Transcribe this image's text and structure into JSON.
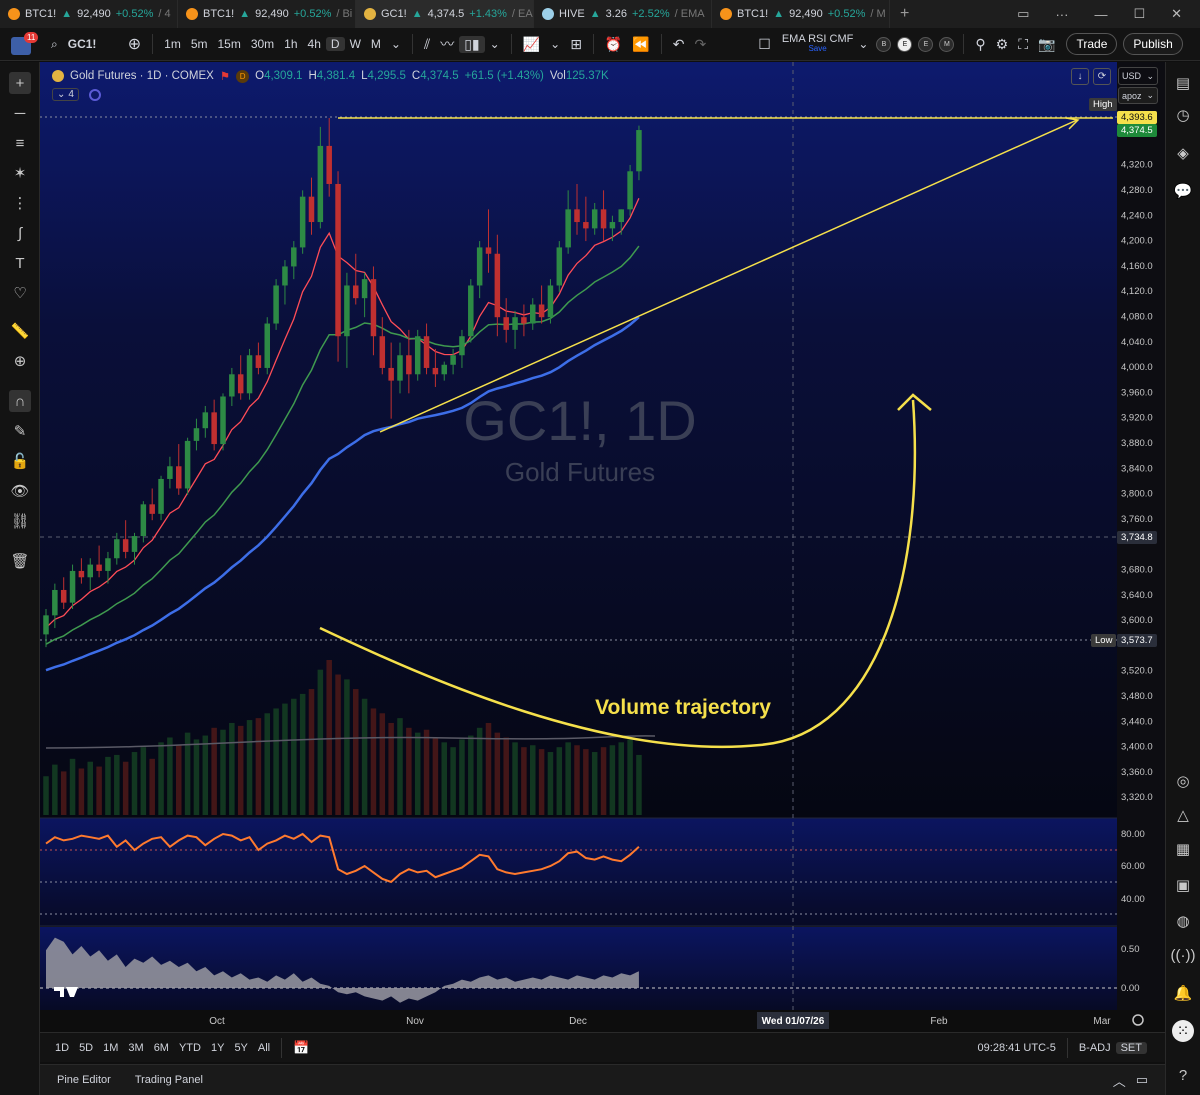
{
  "tabs": [
    {
      "symbol": "BTC1!",
      "price": "92,490",
      "change": "+0.52%",
      "extra": "/ 4"
    },
    {
      "symbol": "BTC1!",
      "price": "92,490",
      "change": "+0.52%",
      "extra": "/ Bi"
    },
    {
      "symbol": "GC1!",
      "price": "4,374.5",
      "change": "+1.43%",
      "extra": "/ EA"
    },
    {
      "symbol": "HIVE",
      "price": "3.26",
      "change": "+2.52%",
      "extra": "/ EMA"
    },
    {
      "symbol": "BTC1!",
      "price": "92,490",
      "change": "+0.52%",
      "extra": "/ M"
    }
  ],
  "toolbar": {
    "badge": "11",
    "symbol": "GC1!",
    "intervals": [
      "1m",
      "5m",
      "15m",
      "30m",
      "1h",
      "4h",
      "D",
      "W",
      "M"
    ],
    "indicators": "EMA RSI CMF",
    "save": "Save",
    "circles": [
      "B",
      "E",
      "E",
      "M"
    ],
    "trade": "Trade",
    "publish": "Publish"
  },
  "legend": {
    "title": "Gold Futures · 1D · COMEX",
    "open": "4,309.1",
    "high": "4,381.4",
    "low": "4,295.5",
    "close": "4,374.5",
    "change": "+61.5 (+1.43%)",
    "vol": "125.37K",
    "collapse": "4"
  },
  "watermark": {
    "symbol": "GC1!, 1D",
    "name": "Gold Futures"
  },
  "annotation": "Volume trajectory",
  "price_axis": {
    "currency": "USD",
    "scale": "apoz",
    "ticks": [
      "4,320.0",
      "4,280.0",
      "4,240.0",
      "4,200.0",
      "4,160.0",
      "4,120.0",
      "4,080.0",
      "4,040.0",
      "4,000.0",
      "3,960.0",
      "3,920.0",
      "3,880.0",
      "3,840.0",
      "3,800.0",
      "3,760.0",
      "3,680.0",
      "3,640.0",
      "3,600.0",
      "3,520.0",
      "3,480.0",
      "3,440.0",
      "3,400.0",
      "3,360.0",
      "3,320.0"
    ],
    "high_label": "High",
    "high_value": "4,393.6",
    "last_value": "4,374.5",
    "crosshair_value": "3,734.8",
    "low_label": "Low",
    "low_value": "3,573.7"
  },
  "rsi_axis": [
    "80.00",
    "60.00",
    "40.00"
  ],
  "cmf_axis": [
    "0.50",
    "0.00"
  ],
  "time_axis": {
    "labels": [
      "Oct",
      "Nov",
      "Dec",
      "Feb",
      "Mar"
    ],
    "crosshair": "Wed 01/07/26"
  },
  "ranges": [
    "1D",
    "5D",
    "1M",
    "3M",
    "6M",
    "YTD",
    "1Y",
    "5Y",
    "All"
  ],
  "status": {
    "clock": "09:28:41 UTC-5",
    "adj": "B-ADJ",
    "session": "SET"
  },
  "panels": [
    "Pine Editor",
    "Trading Panel"
  ],
  "colors": {
    "up": "#1e6b35",
    "down": "#a12a2a",
    "ema_fast": "#ff4d57",
    "ema_mid": "#3f9a4f",
    "ema_slow": "#3d6ee8",
    "rsi": "#ff7a2e",
    "annotation": "#f5e04b"
  },
  "chart_data": {
    "type": "candlestick",
    "price_range": [
      3300,
      4400
    ],
    "candles": [
      [
        3580,
        3620,
        3560,
        3610
      ],
      [
        3610,
        3660,
        3590,
        3650
      ],
      [
        3650,
        3670,
        3620,
        3630
      ],
      [
        3630,
        3690,
        3620,
        3680
      ],
      [
        3680,
        3700,
        3660,
        3670
      ],
      [
        3670,
        3700,
        3650,
        3690
      ],
      [
        3690,
        3720,
        3670,
        3680
      ],
      [
        3680,
        3710,
        3660,
        3700
      ],
      [
        3700,
        3740,
        3690,
        3730
      ],
      [
        3730,
        3760,
        3700,
        3710
      ],
      [
        3710,
        3740,
        3690,
        3735
      ],
      [
        3735,
        3790,
        3725,
        3785
      ],
      [
        3785,
        3810,
        3760,
        3770
      ],
      [
        3770,
        3830,
        3760,
        3825
      ],
      [
        3825,
        3860,
        3810,
        3845
      ],
      [
        3845,
        3880,
        3800,
        3810
      ],
      [
        3810,
        3890,
        3800,
        3885
      ],
      [
        3885,
        3920,
        3870,
        3905
      ],
      [
        3905,
        3940,
        3890,
        3930
      ],
      [
        3930,
        3950,
        3870,
        3880
      ],
      [
        3880,
        3960,
        3870,
        3955
      ],
      [
        3955,
        4000,
        3940,
        3990
      ],
      [
        3990,
        4020,
        3950,
        3960
      ],
      [
        3960,
        4030,
        3950,
        4020
      ],
      [
        4020,
        4040,
        3990,
        4000
      ],
      [
        4000,
        4080,
        3990,
        4070
      ],
      [
        4070,
        4140,
        4060,
        4130
      ],
      [
        4130,
        4170,
        4100,
        4160
      ],
      [
        4160,
        4200,
        4140,
        4190
      ],
      [
        4190,
        4280,
        4180,
        4270
      ],
      [
        4270,
        4300,
        4210,
        4230
      ],
      [
        4230,
        4380,
        4220,
        4350
      ],
      [
        4350,
        4394,
        4270,
        4290
      ],
      [
        4290,
        4310,
        4010,
        4050
      ],
      [
        4050,
        4150,
        4000,
        4130
      ],
      [
        4130,
        4180,
        4100,
        4110
      ],
      [
        4110,
        4150,
        4080,
        4140
      ],
      [
        4140,
        4160,
        4020,
        4050
      ],
      [
        4050,
        4080,
        3990,
        4000
      ],
      [
        4000,
        4040,
        3920,
        3980
      ],
      [
        3980,
        4040,
        3960,
        4020
      ],
      [
        4020,
        4060,
        3960,
        3990
      ],
      [
        3990,
        4060,
        3980,
        4050
      ],
      [
        4050,
        4070,
        3990,
        4000
      ],
      [
        4000,
        4030,
        3970,
        3990
      ],
      [
        3990,
        4010,
        3980,
        4005
      ],
      [
        4005,
        4030,
        3990,
        4020
      ],
      [
        4020,
        4060,
        4000,
        4050
      ],
      [
        4050,
        4140,
        4040,
        4130
      ],
      [
        4130,
        4200,
        4110,
        4190
      ],
      [
        4190,
        4250,
        4150,
        4180
      ],
      [
        4180,
        4210,
        4050,
        4080
      ],
      [
        4080,
        4110,
        4040,
        4060
      ],
      [
        4060,
        4090,
        4030,
        4080
      ],
      [
        4080,
        4100,
        4050,
        4070
      ],
      [
        4070,
        4110,
        4060,
        4100
      ],
      [
        4100,
        4130,
        4070,
        4080
      ],
      [
        4080,
        4140,
        4070,
        4130
      ],
      [
        4130,
        4200,
        4120,
        4190
      ],
      [
        4190,
        4280,
        4180,
        4250
      ],
      [
        4250,
        4290,
        4210,
        4230
      ],
      [
        4230,
        4270,
        4200,
        4220
      ],
      [
        4220,
        4260,
        4210,
        4250
      ],
      [
        4250,
        4280,
        4200,
        4220
      ],
      [
        4220,
        4240,
        4200,
        4230
      ],
      [
        4230,
        4250,
        4210,
        4250
      ],
      [
        4250,
        4320,
        4240,
        4310
      ],
      [
        4310,
        4382,
        4296,
        4375
      ]
    ],
    "volume": [
      40,
      52,
      45,
      58,
      48,
      55,
      50,
      60,
      62,
      55,
      65,
      70,
      58,
      75,
      80,
      72,
      85,
      78,
      82,
      90,
      88,
      95,
      92,
      98,
      100,
      105,
      110,
      115,
      120,
      125,
      130,
      150,
      160,
      145,
      140,
      130,
      120,
      110,
      105,
      95,
      100,
      90,
      85,
      88,
      80,
      75,
      70,
      78,
      82,
      90,
      95,
      85,
      80,
      75,
      70,
      72,
      68,
      65,
      70,
      75,
      72,
      68,
      65,
      70,
      72,
      75,
      78,
      62
    ],
    "rsi": [
      74,
      78,
      76,
      77,
      79,
      78,
      77,
      79,
      72,
      76,
      70,
      74,
      77,
      78,
      72,
      76,
      79,
      78,
      73,
      77,
      80,
      79,
      76,
      78,
      70,
      74,
      76,
      79,
      77,
      80,
      75,
      79,
      78,
      58,
      55,
      57,
      60,
      56,
      52,
      50,
      55,
      58,
      56,
      57,
      53,
      55,
      57,
      59,
      63,
      67,
      66,
      58,
      56,
      55,
      56,
      57,
      58,
      60,
      63,
      68,
      69,
      65,
      64,
      66,
      64,
      63,
      67,
      72
    ],
    "cmf": [
      0.18,
      0.24,
      0.22,
      0.16,
      0.2,
      0.15,
      0.18,
      0.13,
      0.16,
      0.1,
      0.14,
      0.12,
      0.15,
      0.11,
      0.13,
      0.1,
      0.12,
      0.08,
      0.1,
      0.06,
      0.08,
      0.05,
      0.07,
      0.04,
      0.05,
      0.03,
      0.06,
      0.04,
      0.07,
      0.03,
      0.05,
      0.02,
      0.01,
      -0.02,
      -0.03,
      -0.02,
      -0.04,
      -0.05,
      -0.06,
      -0.04,
      -0.07,
      -0.05,
      -0.06,
      -0.04,
      -0.02,
      0.01,
      0.02,
      0.04,
      0.03,
      0.05,
      0.06,
      0.04,
      0.05,
      0.03,
      0.04,
      0.05,
      0.04,
      0.06,
      0.05,
      0.04,
      0.06,
      0.05,
      0.04,
      0.06,
      0.05,
      0.07,
      0.06,
      0.08
    ]
  }
}
